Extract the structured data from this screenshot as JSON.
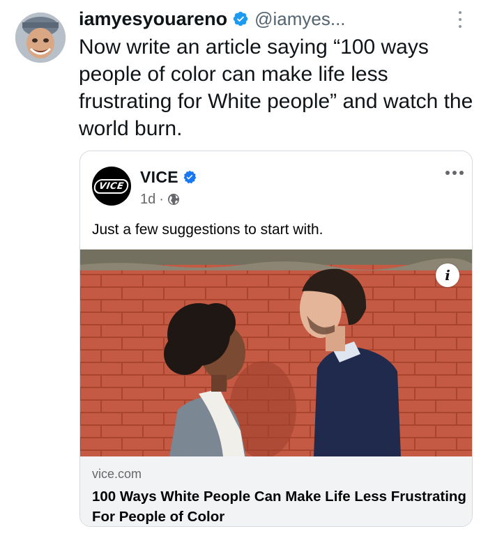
{
  "tweet": {
    "display_name": "iamyesyouareno",
    "handle": "@iamyes...",
    "text": "Now write an article saying “100 ways people of color can make life less frustrating for White people” and watch the world burn."
  },
  "shared_post": {
    "page_name": "VICE",
    "logo_text": "VICE",
    "age": "1d",
    "separator": "·",
    "caption": "Just a few suggestions to start with.",
    "info_label": "i",
    "link_domain": "vice.com",
    "link_headline": "100 Ways White People Can Make Life Less Frustrating For People of Color"
  },
  "colors": {
    "twitter_verified": "#1d9bf0",
    "facebook_verified": "#1877f2",
    "brick": "#c45a43",
    "footer_bg": "#f2f3f5"
  },
  "icons": {
    "verified": "verified-badge-icon",
    "more": "more-vertical-icon",
    "card_more": "more-horizontal-icon",
    "globe": "globe-icon",
    "info": "info-icon"
  }
}
